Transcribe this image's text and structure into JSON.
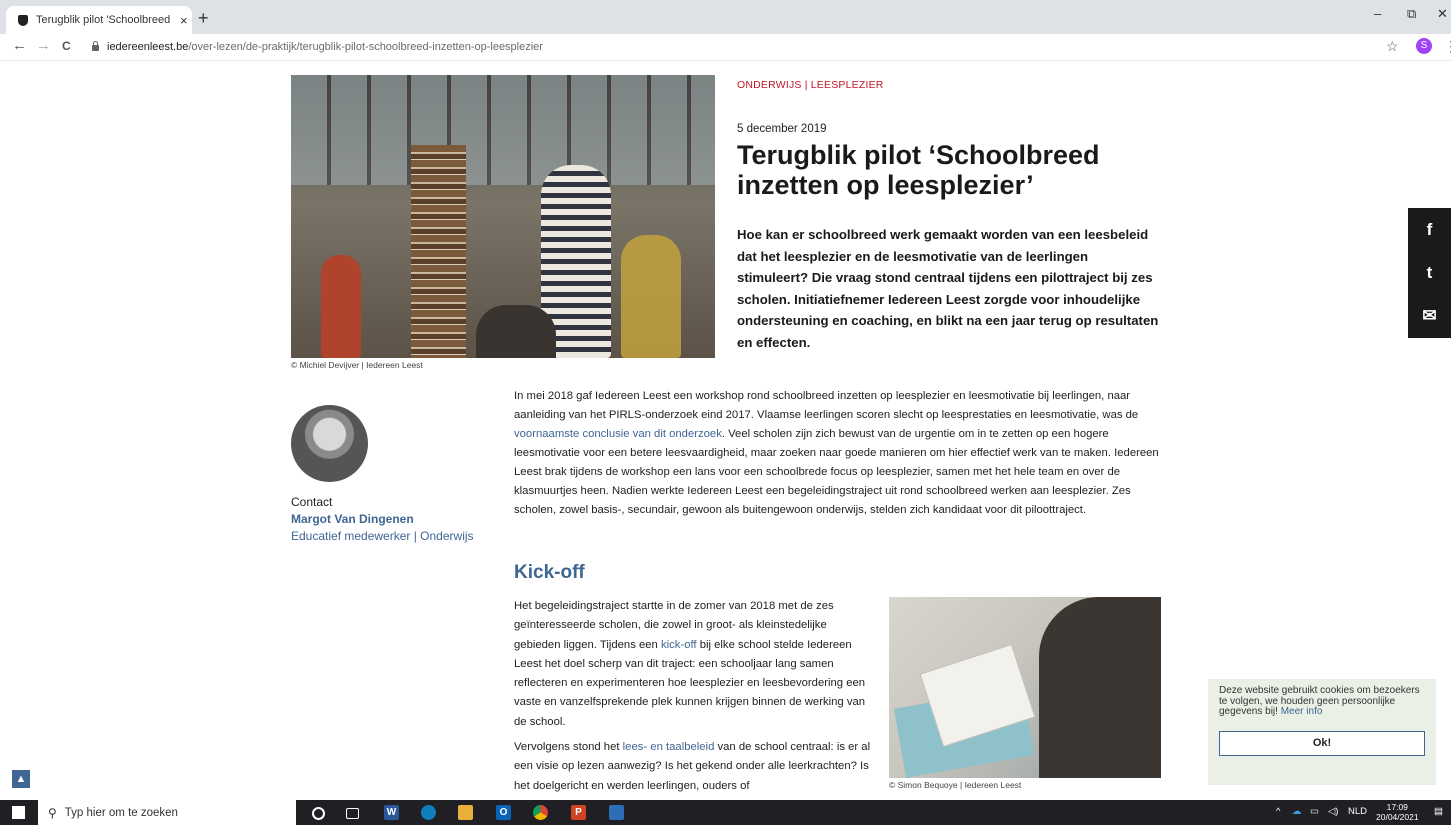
{
  "browser": {
    "tab_title": "Terugblik pilot 'Schoolbreed inze",
    "tab_close": "×",
    "new_tab": "+",
    "url_host": "iedereenleest.be",
    "url_path": "/over-lezen/de-praktijk/terugblik-pilot-schoolbreed-inzetten-op-leesplezier",
    "profile_initial": "S",
    "nav": {
      "back": "←",
      "forward": "→",
      "reload": "C"
    },
    "window": {
      "minimize": "–",
      "maximize": "⧉",
      "close": "✕"
    }
  },
  "article": {
    "categories": "ONDERWIJS  |  LEESPLEZIER",
    "date": "5 december 2019",
    "title": "Terugblik pilot ‘Schoolbreed inzetten op leesplezier’",
    "intro": "Hoe kan er schoolbreed werk gemaakt worden van een leesbeleid dat het leesplezier en de leesmotivatie van de leerlingen stimuleert? Die vraag stond centraal tijdens een pilottraject bij zes scholen. Initiatiefnemer Iedereen Leest zorgde voor inhoudelijke ondersteuning en coaching, en blikt na een jaar terug op resultaten en effecten.",
    "hero_credit": "© Michiel Devijver | Iedereen Leest",
    "p1_before": "In mei 2018 gaf Iedereen Leest een workshop rond schoolbreed inzetten op leesplezier en leesmotivatie bij leerlingen, naar aanleiding van het PIRLS-onderzoek eind 2017. Vlaamse leerlingen scoren slecht op leesprestaties en leesmotivatie, was de ",
    "p1_link": "voornaamste conclusie van dit onderzoek",
    "p1_after": ". Veel scholen zijn zich bewust van de urgentie om in te zetten op een hogere leesmotivatie voor een betere leesvaardigheid, maar zoeken naar goede manieren om hier effectief werk van te maken. Iedereen Leest brak tijdens de workshop een lans voor een schoolbrede focus op leesplezier, samen met het hele team en over de klasmuurtjes heen. Nadien werkte Iedereen Leest een begeleidingstraject uit rond schoolbreed werken aan leesplezier. Zes scholen, zowel basis-, secundair, gewoon als buitengewoon onderwijs, stelden zich kandidaat voor dit piloottraject.",
    "section_heading": "Kick-off",
    "p2_before": "Het begeleidingstraject startte in de zomer van 2018 met de zes geïnteresseerde scholen, die zowel in groot- als kleinstedelijke gebieden liggen. Tijdens een ",
    "p2_link": "kick-off",
    "p2_after": " bij elke school stelde Iedereen Leest het doel scherp van dit traject: een schooljaar lang samen reflecteren en experimenteren hoe leesplezier en leesbevordering een vaste en vanzelfsprekende plek kunnen krijgen binnen de werking van de school.",
    "p3_before": "Vervolgens stond het ",
    "p3_link": "lees- en taalbeleid",
    "p3_after": " van de school centraal: is er al een visie op lezen aanwezig? Is het gekend onder alle leerkrachten? Is het doelgericht en werden leerlingen, ouders of",
    "fig2_credit": "© Simon Bequoye | Iedereen Leest"
  },
  "contact": {
    "label": "Contact",
    "name": "Margot Van Dingenen",
    "role": "Educatief medewerker | Onderwijs"
  },
  "social": {
    "facebook": "f",
    "twitter": "t",
    "email": "✉"
  },
  "cookie": {
    "text": "Deze website gebruikt cookies om bezoekers te volgen, we houden geen persoonlijke gegevens bij! ",
    "link": "Meer info",
    "button": "Ok!"
  },
  "scroll_top": "▲",
  "taskbar": {
    "search_placeholder": "Typ hier om te zoeken",
    "language": "NLD",
    "time": "17:09",
    "date": "20/04/2021"
  }
}
